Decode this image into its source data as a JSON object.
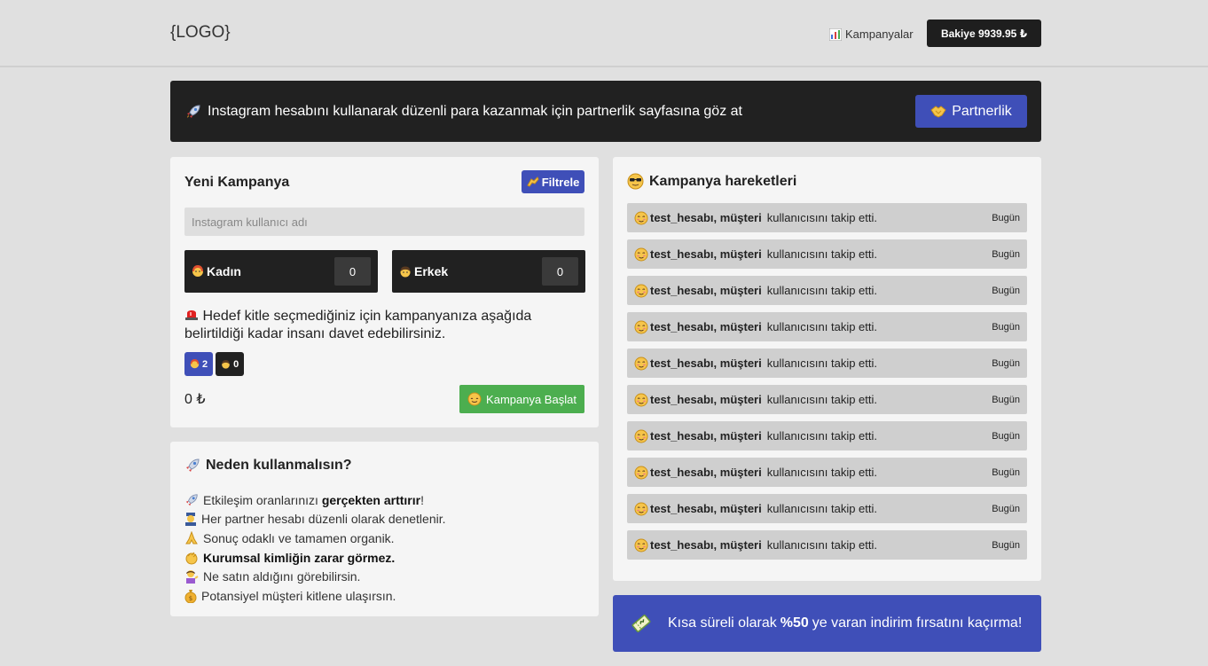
{
  "header": {
    "logo": "{LOGO}",
    "campaigns_label": "Kampanyalar",
    "balance_label": "Bakiye 9939.95 ₺"
  },
  "banner": {
    "text": "Instagram hesabını kullanarak düzenli para kazanmak için partnerlik sayfasına göz at",
    "button_label": "Partnerlik"
  },
  "new_campaign": {
    "title": "Yeni Kampanya",
    "filter_label": "Filtrele",
    "username_placeholder": "Instagram kullanıcı adı",
    "female_label": "Kadın",
    "female_count": "0",
    "male_label": "Erkek",
    "male_count": "0",
    "info_text": "Hedef kitle seçmediğiniz için kampanyanıza aşağıda belirtildiği kadar insanı davet edebilirsiniz.",
    "chip_female": "2",
    "chip_male": "0",
    "price": "0 ₺",
    "start_label": "Kampanya Başlat"
  },
  "why": {
    "title": "Neden kullanmalısın?",
    "items": [
      {
        "pre": "Etkileşim oranlarınızı ",
        "bold": "gerçekten arttırır",
        "post": "!"
      },
      {
        "pre": "Her partner hesabı düzenli olarak denetlenir.",
        "bold": "",
        "post": ""
      },
      {
        "pre": "Sonuç odaklı ve tamamen organik.",
        "bold": "",
        "post": ""
      },
      {
        "pre": "",
        "bold": "Kurumsal kimliğin zarar görmez.",
        "post": ""
      },
      {
        "pre": "Ne satın aldığını görebilirsin.",
        "bold": "",
        "post": ""
      },
      {
        "pre": "Potansiyel müşteri kitlene ulaşırsın.",
        "bold": "",
        "post": ""
      }
    ]
  },
  "activity": {
    "title": "Kampanya hareketleri",
    "rows": [
      {
        "user": "test_hesabı, müşteri",
        "action": "kullanıcısını takip etti.",
        "time": "Bugün"
      },
      {
        "user": "test_hesabı, müşteri",
        "action": "kullanıcısını takip etti.",
        "time": "Bugün"
      },
      {
        "user": "test_hesabı, müşteri",
        "action": "kullanıcısını takip etti.",
        "time": "Bugün"
      },
      {
        "user": "test_hesabı, müşteri",
        "action": "kullanıcısını takip etti.",
        "time": "Bugün"
      },
      {
        "user": "test_hesabı, müşteri",
        "action": "kullanıcısını takip etti.",
        "time": "Bugün"
      },
      {
        "user": "test_hesabı, müşteri",
        "action": "kullanıcısını takip etti.",
        "time": "Bugün"
      },
      {
        "user": "test_hesabı, müşteri",
        "action": "kullanıcısını takip etti.",
        "time": "Bugün"
      },
      {
        "user": "test_hesabı, müşteri",
        "action": "kullanıcısını takip etti.",
        "time": "Bugün"
      },
      {
        "user": "test_hesabı, müşteri",
        "action": "kullanıcısını takip etti.",
        "time": "Bugün"
      },
      {
        "user": "test_hesabı, müşteri",
        "action": "kullanıcısını takip etti.",
        "time": "Bugün"
      }
    ]
  },
  "discount": {
    "pre": "Kısa süreli olarak",
    "bold": "%50",
    "post": "ye varan indirim fırsatını kaçırma!"
  },
  "colors": {
    "accent": "#3f4fb8",
    "dark": "#212121",
    "success": "#4cae4f",
    "background": "#e0e0e0",
    "card": "#f5f5f5"
  }
}
